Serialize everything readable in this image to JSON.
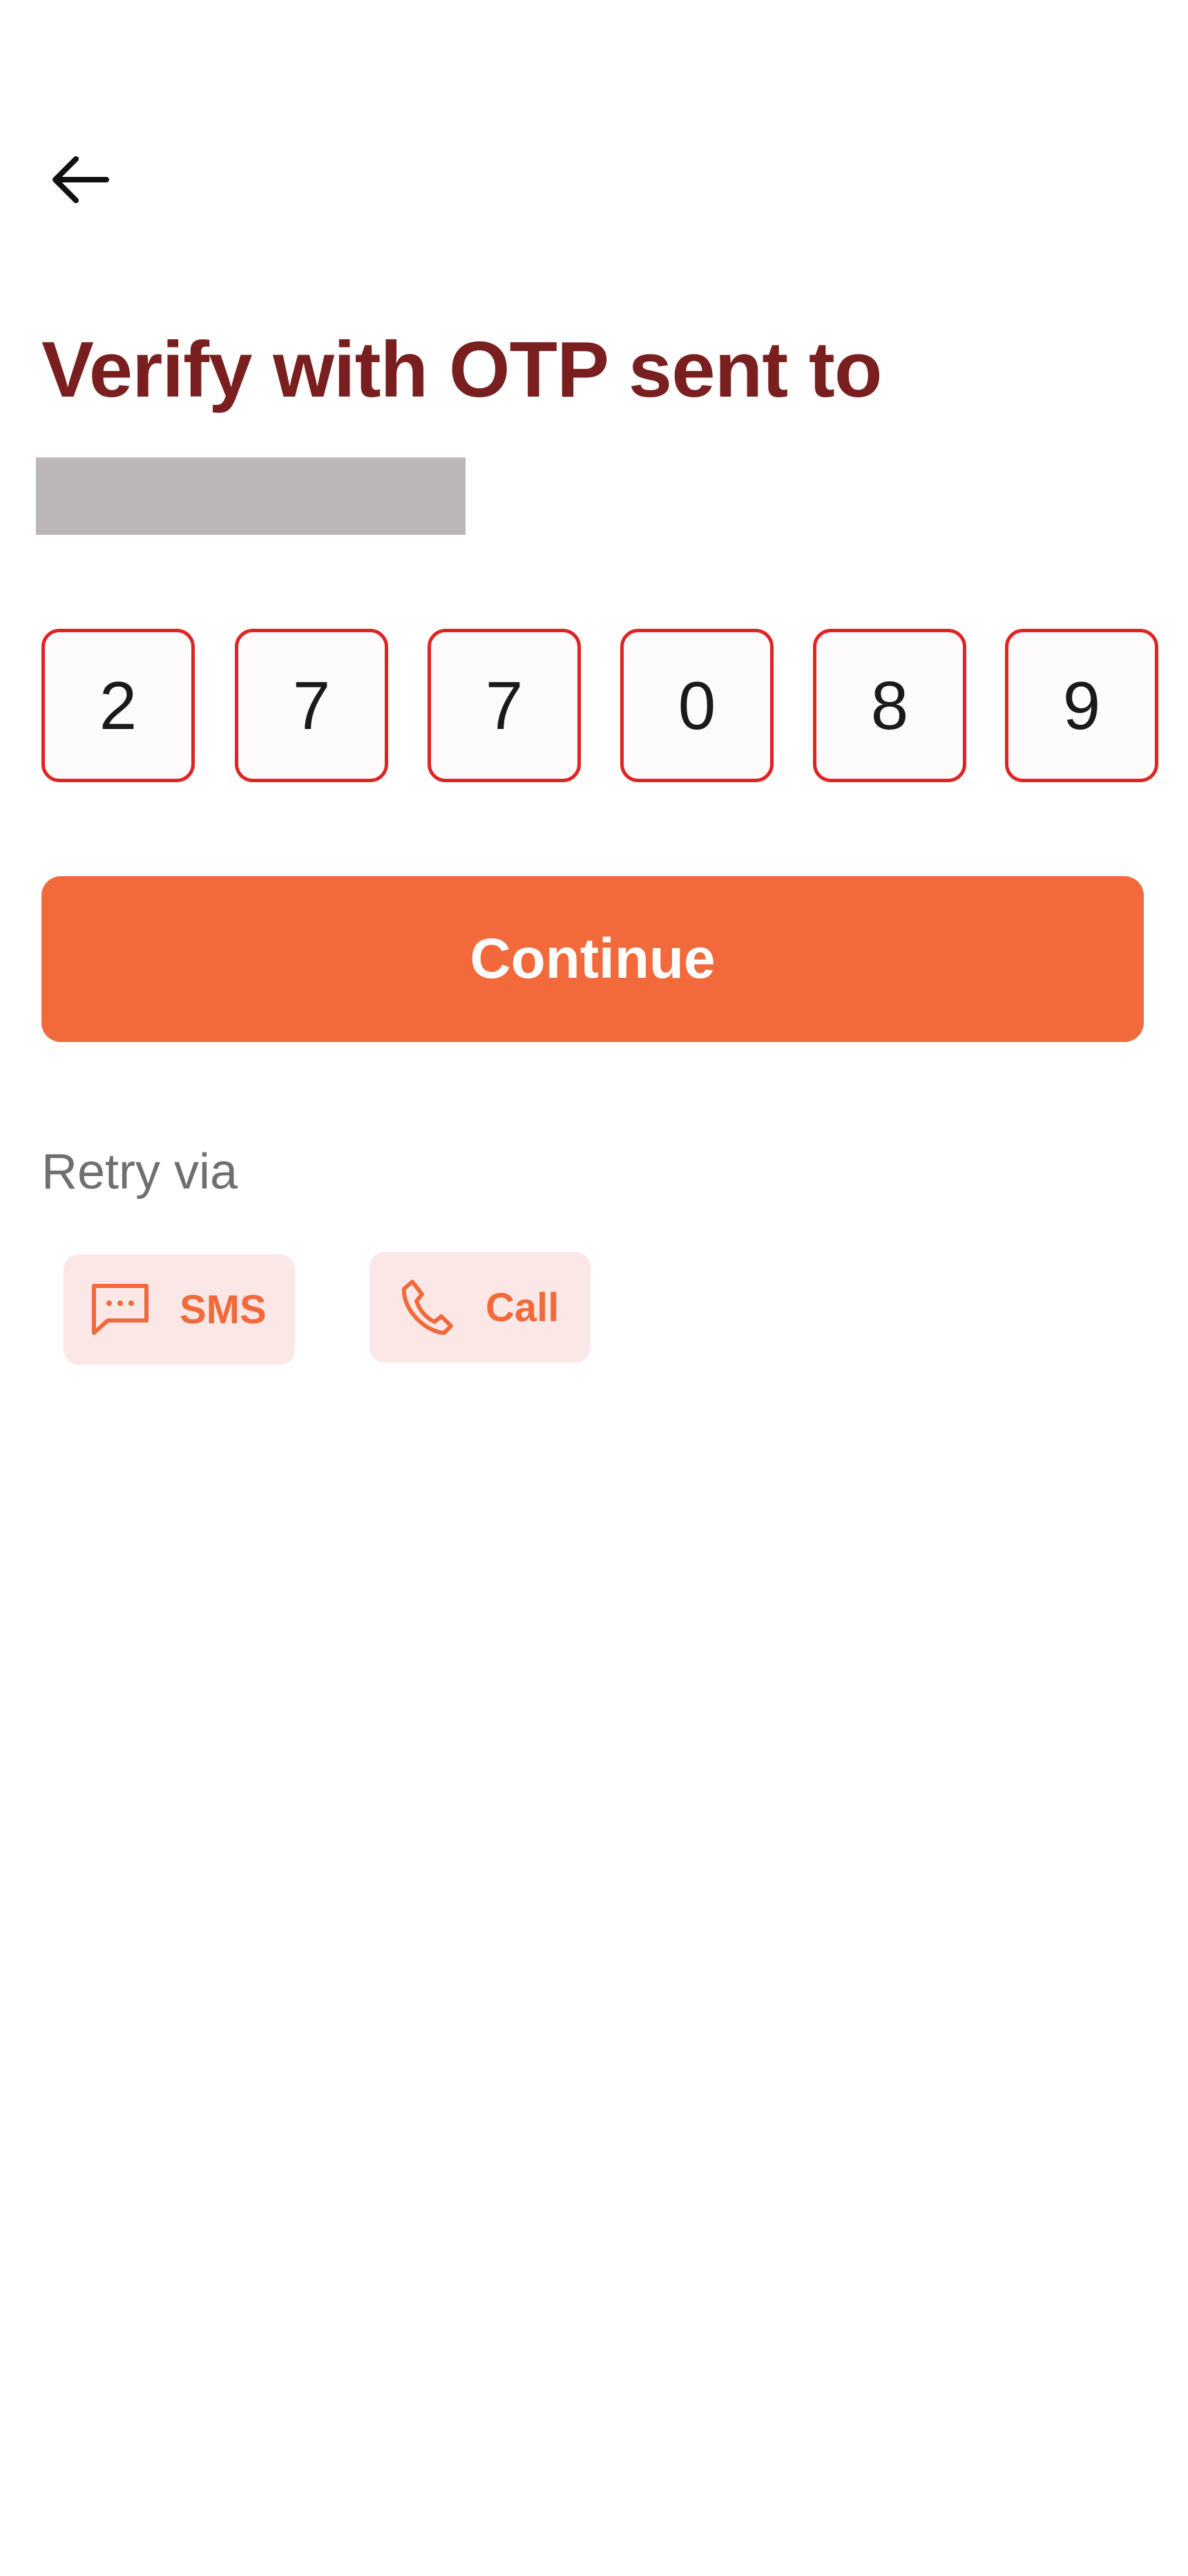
{
  "header": {
    "back_icon": "arrow-left-icon"
  },
  "title": "Verify with OTP sent to",
  "otp": {
    "digits": [
      "2",
      "7",
      "7",
      "0",
      "8",
      "9"
    ]
  },
  "continue_label": "Continue",
  "retry": {
    "label": "Retry via",
    "options": [
      {
        "label": "SMS",
        "icon": "message-icon"
      },
      {
        "label": "Call",
        "icon": "phone-icon"
      }
    ]
  },
  "colors": {
    "title": "#7a1f1f",
    "accent": "#f26a3b",
    "otp_border": "#e02424",
    "chip_bg": "#fbe8e6",
    "redaction": "#bbb7b7"
  }
}
